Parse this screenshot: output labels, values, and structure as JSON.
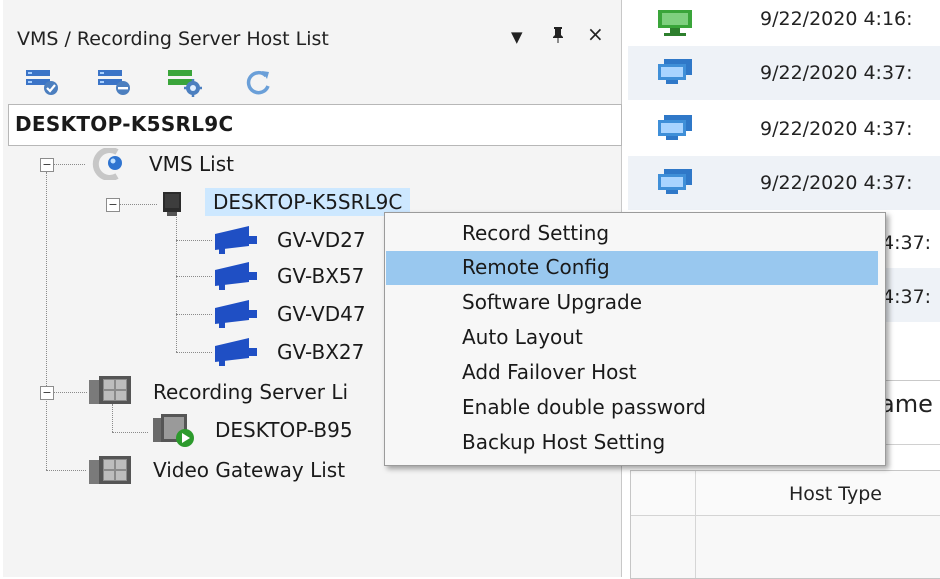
{
  "panel": {
    "title": "VMS / Recording Server Host List",
    "dropdown_glyph": "▾",
    "pin_glyph": "ᵖ",
    "close_glyph": "×",
    "toolbar": [
      {
        "icon": "add-host-icon"
      },
      {
        "icon": "remove-host-icon"
      },
      {
        "icon": "host-settings-icon"
      },
      {
        "icon": "refresh-icon"
      }
    ],
    "host_name": "DESKTOP-K5SRL9C"
  },
  "tree": {
    "vms_list": "VMS List",
    "desktop": "DESKTOP-K5SRL9C",
    "cameras": [
      "GV-VD27",
      "GV-BX57",
      "GV-VD47",
      "GV-BX27"
    ],
    "recording_server": "Recording Server Li",
    "recording_host": "DESKTOP-B95",
    "video_gateway": "Video Gateway List"
  },
  "log": {
    "rows": [
      {
        "time": "9/22/2020 4:16:",
        "icon": "monitor-green-icon"
      },
      {
        "time": "9/22/2020 4:37:",
        "icon": "monitor-blue-icon"
      },
      {
        "time": "9/22/2020 4:37:",
        "icon": "monitor-blue-icon"
      },
      {
        "time": "9/22/2020 4:37:",
        "icon": "monitor-blue-icon"
      },
      {
        "time": "4:37:",
        "icon": ""
      },
      {
        "time": "4:37:",
        "icon": ""
      }
    ],
    "partial_label": "ame",
    "grid_column": "Host Type"
  },
  "context_menu": {
    "items": [
      "Record Setting",
      "Remote Config",
      "Software Upgrade",
      "Auto Layout",
      "Add Failover Host",
      "Enable double password",
      "Backup Host Setting"
    ],
    "active_index": 1
  },
  "colors": {
    "selection": "#cde8ff",
    "menu_highlight": "#99c8ef",
    "camera_blue": "#1f4fc4",
    "monitor_green": "#3aa53a",
    "monitor_blue": "#3f8fd8"
  }
}
